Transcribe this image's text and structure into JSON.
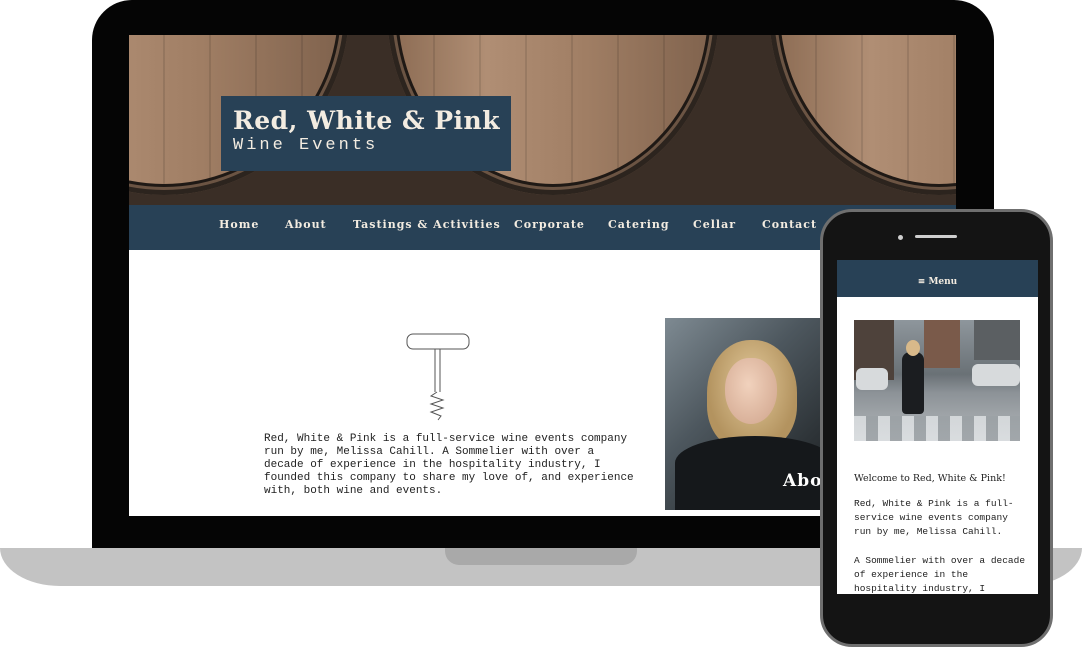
{
  "desktop": {
    "brand_title": "Red, White & Pink",
    "brand_subtitle": "Wine Events",
    "nav": [
      "Home",
      "About",
      "Tastings & Activities",
      "Corporate",
      "Catering",
      "Cellar",
      "Contact"
    ],
    "intro": "Red, White & Pink is a full-service wine events company run by me, Melissa Cahill. A Sommelier with over a decade of experience in the hospitality industry, I founded this company to share my love of, and experience with, both wine and events.",
    "about_label": "Abo"
  },
  "mobile": {
    "menu_label": "≡ Menu",
    "welcome": "Welcome to Red, White & Pink!",
    "para1": "Red, White & Pink is a full-service wine events company run by me, Melissa Cahill.",
    "para2": "A Sommelier with over a decade of experience in the hospitality industry, I"
  },
  "colors": {
    "navy": "#284156",
    "cream": "#f3ece1"
  }
}
